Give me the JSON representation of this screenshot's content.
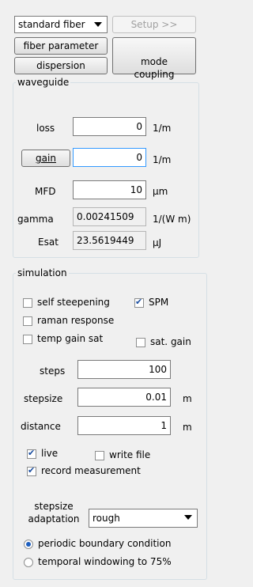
{
  "top": {
    "fiber_type": "standard fiber",
    "setup_label": "Setup >>",
    "fiber_param_label": "fiber parameter",
    "dispersion_label": "dispersion",
    "mode_coupling_label": "mode\ncoupling"
  },
  "waveguide": {
    "title": "waveguide",
    "loss_label": "loss",
    "loss_value": "0",
    "loss_unit": "1/m",
    "gain_label": "gain",
    "gain_value": "0",
    "gain_unit": "1/m",
    "mfd_label": "MFD",
    "mfd_value": "10",
    "mfd_unit": "µm",
    "gamma_label": "gamma",
    "gamma_value": "0.00241509",
    "gamma_unit": "1/(W m)",
    "esat_label": "Esat",
    "esat_value": "23.5619449",
    "esat_unit": "µJ"
  },
  "simulation": {
    "title": "simulation",
    "self_steepening": "self steepening",
    "spm": "SPM",
    "raman": "raman response",
    "temp_gain_sat": "temp gain sat",
    "sat_gain": "sat. gain",
    "steps_label": "steps",
    "steps_value": "100",
    "stepsize_label": "stepsize",
    "stepsize_value": "0.01",
    "stepsize_unit": "m",
    "distance_label": "distance",
    "distance_value": "1",
    "distance_unit": "m",
    "live": "live",
    "write_file": "write file",
    "record": "record measurement",
    "adapt_label": "stepsize\nadaptation",
    "adapt_value": "rough",
    "periodic": "periodic boundary condition",
    "temporal": "temporal windowing to 75%"
  }
}
